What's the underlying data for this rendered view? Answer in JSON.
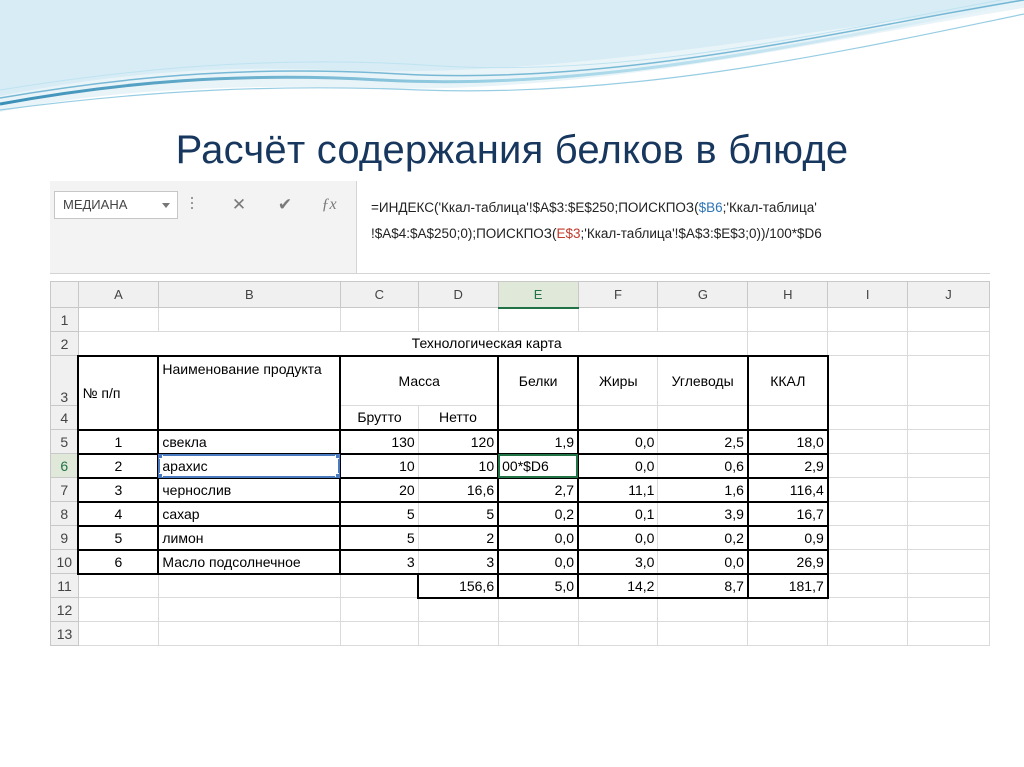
{
  "slide": {
    "title": "Расчёт содержания белков в блюде"
  },
  "formula_bar": {
    "name_box": "МЕДИАНА",
    "cancel_icon": "close-icon",
    "enter_icon": "check-icon",
    "function_icon": "fx-icon",
    "formula_line1_a": "=ИНДЕКС('Ккал-таблица'!$A$3:$E$250;ПОИСКПОЗ(",
    "formula_line1_ref": "$B6",
    "formula_line1_b": ";'Ккал-таблица'",
    "formula_line2_a": "!$A$4:$A$250;0);ПОИСКПОЗ(",
    "formula_line2_ref": "E$3",
    "formula_line2_b": ";'Ккал-таблица'!$A$3:$E$3;0))/100*$D6"
  },
  "columns": [
    "A",
    "B",
    "C",
    "D",
    "E",
    "F",
    "G",
    "H",
    "I",
    "J"
  ],
  "rows": [
    "1",
    "2",
    "3",
    "4",
    "5",
    "6",
    "7",
    "8",
    "9",
    "10",
    "11",
    "12",
    "13"
  ],
  "sheet": {
    "table_title": "Технологическая карта",
    "headers": {
      "num": "№ п/п",
      "name": "Наименование продукта",
      "mass": "Масса",
      "protein": "Белки",
      "fat": "Жиры",
      "carbs": "Углеводы",
      "kcal": "ККАЛ",
      "gross": "Брутто",
      "net": "Нетто"
    },
    "items": [
      {
        "num": "1",
        "name": "свекла",
        "gross": "130",
        "net": "120",
        "protein": "1,9",
        "fat": "0,0",
        "carbs": "2,5",
        "kcal": "18,0"
      },
      {
        "num": "2",
        "name": "арахис",
        "gross": "10",
        "net": "10",
        "protein": "00*$D6",
        "fat": "0,0",
        "carbs": "0,6",
        "kcal": "2,9"
      },
      {
        "num": "3",
        "name": "чернослив",
        "gross": "20",
        "net": "16,6",
        "protein": "2,7",
        "fat": "11,1",
        "carbs": "1,6",
        "kcal": "116,4"
      },
      {
        "num": "4",
        "name": "сахар",
        "gross": "5",
        "net": "5",
        "protein": "0,2",
        "fat": "0,1",
        "carbs": "3,9",
        "kcal": "16,7"
      },
      {
        "num": "5",
        "name": "лимон",
        "gross": "5",
        "net": "2",
        "protein": "0,0",
        "fat": "0,0",
        "carbs": "0,2",
        "kcal": "0,9"
      },
      {
        "num": "6",
        "name": "Масло подсолнечное",
        "gross": "3",
        "net": "3",
        "protein": "0,0",
        "fat": "3,0",
        "carbs": "0,0",
        "kcal": "26,9"
      }
    ],
    "totals": {
      "net": "156,6",
      "protein": "5,0",
      "fat": "14,2",
      "carbs": "8,7",
      "kcal": "181,7"
    }
  },
  "colors": {
    "title": "#17375e",
    "selection_green": "#217346",
    "selection_blue": "#4a7ac0",
    "ref_b6": "#2e75b6",
    "ref_e3": "#c0392b"
  }
}
